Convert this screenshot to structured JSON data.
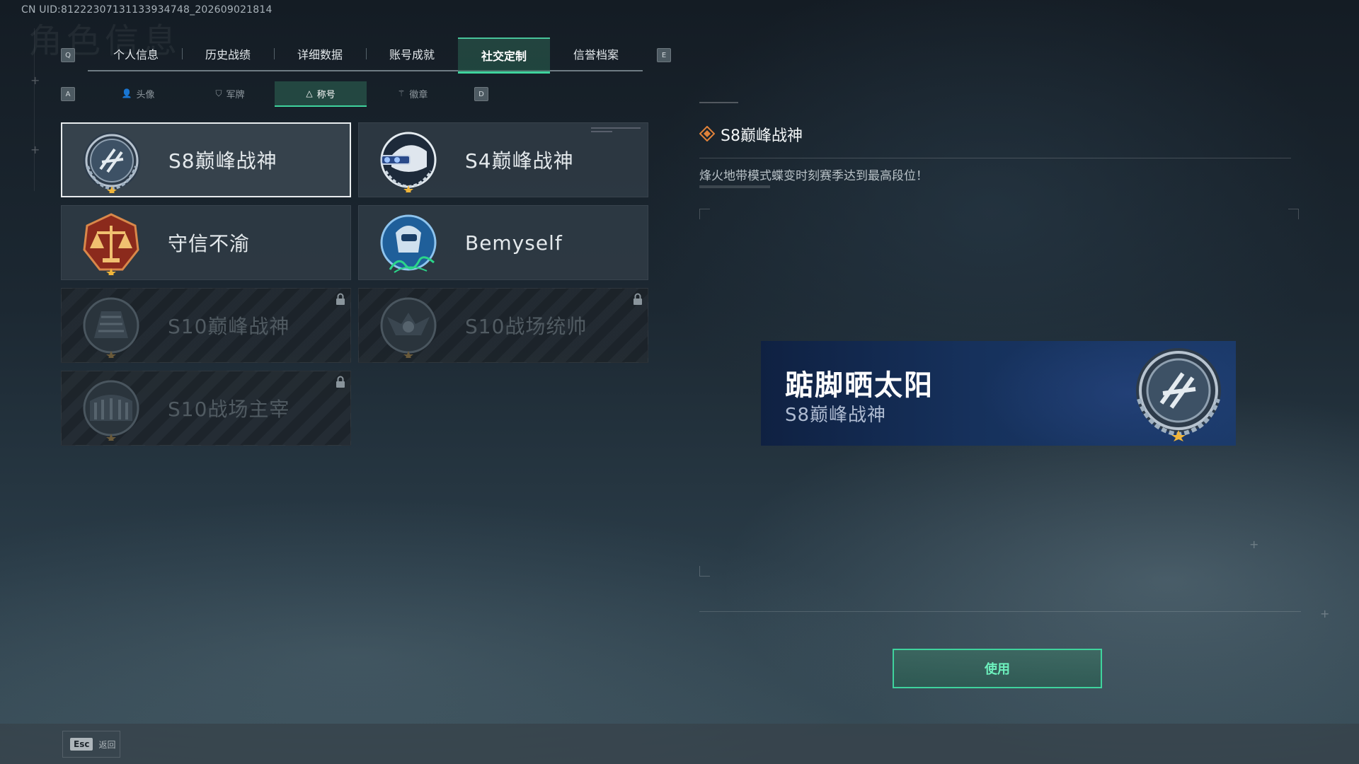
{
  "header": {
    "uid_text": "CN UID:8122230713113393474​8_202609021814",
    "ghost_title": "角色信息"
  },
  "tabs": {
    "prev_key": "Q",
    "next_key": "E",
    "items": [
      {
        "label": "个人信息",
        "active": false
      },
      {
        "label": "历史战绩",
        "active": false
      },
      {
        "label": "详细数据",
        "active": false
      },
      {
        "label": "账号成就",
        "active": false
      },
      {
        "label": "社交定制",
        "active": true
      },
      {
        "label": "信誉档案",
        "active": false
      }
    ]
  },
  "subtabs": {
    "prev_key": "A",
    "next_key": "D",
    "items": [
      {
        "label": "头像",
        "icon": "person-icon",
        "active": false
      },
      {
        "label": "军牌",
        "icon": "dogtag-icon",
        "active": false
      },
      {
        "label": "称号",
        "icon": "triangle-icon",
        "active": true
      },
      {
        "label": "徽章",
        "icon": "wings-icon",
        "active": false
      }
    ]
  },
  "titles": [
    {
      "label": "S8巅峰战神",
      "emblem": "s8-peak-emblem",
      "selected": true,
      "locked": false
    },
    {
      "label": "S4巅峰战神",
      "emblem": "s4-peak-emblem",
      "selected": false,
      "locked": false
    },
    {
      "label": "守信不渝",
      "emblem": "scales-emblem",
      "selected": false,
      "locked": false
    },
    {
      "label": "Bemyself",
      "emblem": "bemyself-emblem",
      "selected": false,
      "locked": false
    },
    {
      "label": "S10巅峰战神",
      "emblem": "s10-peak-emblem",
      "selected": false,
      "locked": true
    },
    {
      "label": "S10战场统帅",
      "emblem": "s10-commander-emblem",
      "selected": false,
      "locked": true
    },
    {
      "label": "S10战场主宰",
      "emblem": "s10-dominator-emblem",
      "selected": false,
      "locked": true
    }
  ],
  "detail": {
    "title": "S8巅峰战神",
    "description": "烽火地带模式蝶变时刻赛季达到最高段位！"
  },
  "preview": {
    "player_name": "踮脚晒太阳",
    "title": "S8巅峰战神"
  },
  "actions": {
    "use_label": "使用"
  },
  "footer": {
    "esc_key": "Esc",
    "back_label": "返回"
  },
  "colors": {
    "accent": "#3fd39d",
    "selected_border": "#e8ecee",
    "banner_blue": "#16315c",
    "diamond_orange": "#e0823a"
  }
}
